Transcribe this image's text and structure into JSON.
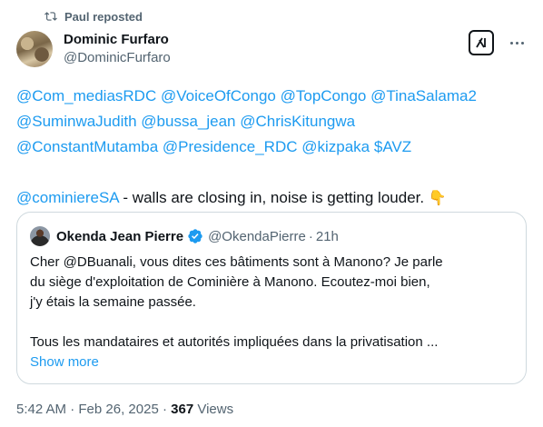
{
  "repost": {
    "label": "Paul reposted",
    "icon": "repost-icon"
  },
  "author": {
    "name": "Dominic Furfaro",
    "handle": "@DominicFurfaro",
    "avatar": "profile-photo"
  },
  "actions": {
    "grok_icon": "grok-icon",
    "more_icon": "more-icon"
  },
  "tweet": {
    "mentions": [
      "@Com_mediasRDC",
      "@VoiceOfCongo",
      "@TopCongo",
      "@TinaSalama2",
      "@SuminwaJudith",
      "@bussa_jean",
      "@ChrisKitungwa",
      "@ConstantMutamba",
      "@Presidence_RDC",
      "@kizpaka",
      "$AVZ"
    ],
    "reply_mention": "@cominiereSA",
    "text": " - walls are closing in, noise is getting louder. ",
    "emoji": "👇"
  },
  "quote": {
    "name": "Okenda Jean Pierre",
    "verified": true,
    "handle": "@OkendaPierre",
    "separator": "·",
    "time": "21h",
    "lines": [
      "Cher @DBuanali, vous dites ces bâtiments sont à Manono? Je parle",
      "du siège d'exploitation de Cominière à Manono. Ecoutez-moi bien,",
      "j'y étais la semaine passée.",
      "Tous les mandataires et autorités impliquées dans la privatisation ..."
    ],
    "show_more": "Show more"
  },
  "meta": {
    "time": "5:42 AM",
    "separator1": "·",
    "date": "Feb 26, 2025",
    "separator2": "·",
    "views_count": "367",
    "views_label": "Views"
  },
  "colors": {
    "link": "#1d9bf0",
    "muted": "#536471",
    "text": "#0f1419",
    "border": "#cfd9de"
  }
}
